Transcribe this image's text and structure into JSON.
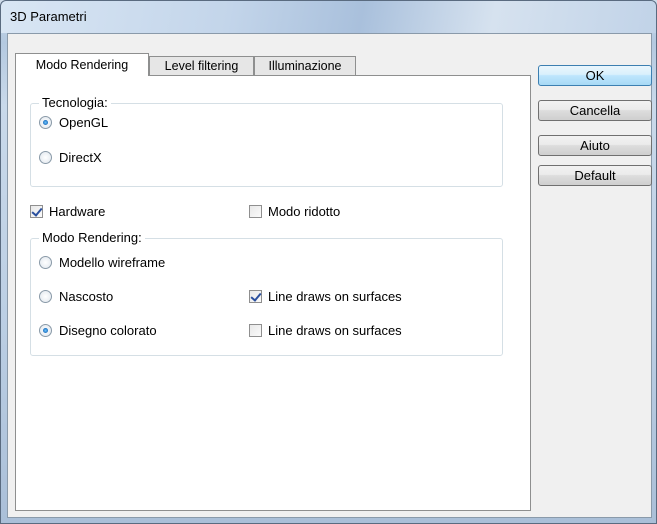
{
  "window": {
    "title": "3D Parametri"
  },
  "tabs": [
    {
      "label": "Modo Rendering",
      "active": true
    },
    {
      "label": "Level filtering",
      "active": false
    },
    {
      "label": "Illuminazione",
      "active": false
    }
  ],
  "tecnologia": {
    "label": "Tecnologia:",
    "options": [
      {
        "label": "OpenGL",
        "checked": true
      },
      {
        "label": "DirectX",
        "checked": false
      }
    ]
  },
  "hardware": {
    "label": "Hardware",
    "checked": true
  },
  "modo_ridotto": {
    "label": "Modo ridotto",
    "checked": false
  },
  "modo_rendering": {
    "label": "Modo Rendering:",
    "options": [
      {
        "label": "Modello wireframe",
        "checked": false
      },
      {
        "label": "Nascosto",
        "checked": false
      },
      {
        "label": "Disegno colorato",
        "checked": true
      }
    ],
    "line_draws": [
      {
        "label": "Line draws on surfaces",
        "checked": true
      },
      {
        "label": "Line draws on surfaces",
        "checked": false
      }
    ]
  },
  "buttons": {
    "ok": "OK",
    "cancel": "Cancella",
    "help": "Aiuto",
    "default": "Default"
  }
}
